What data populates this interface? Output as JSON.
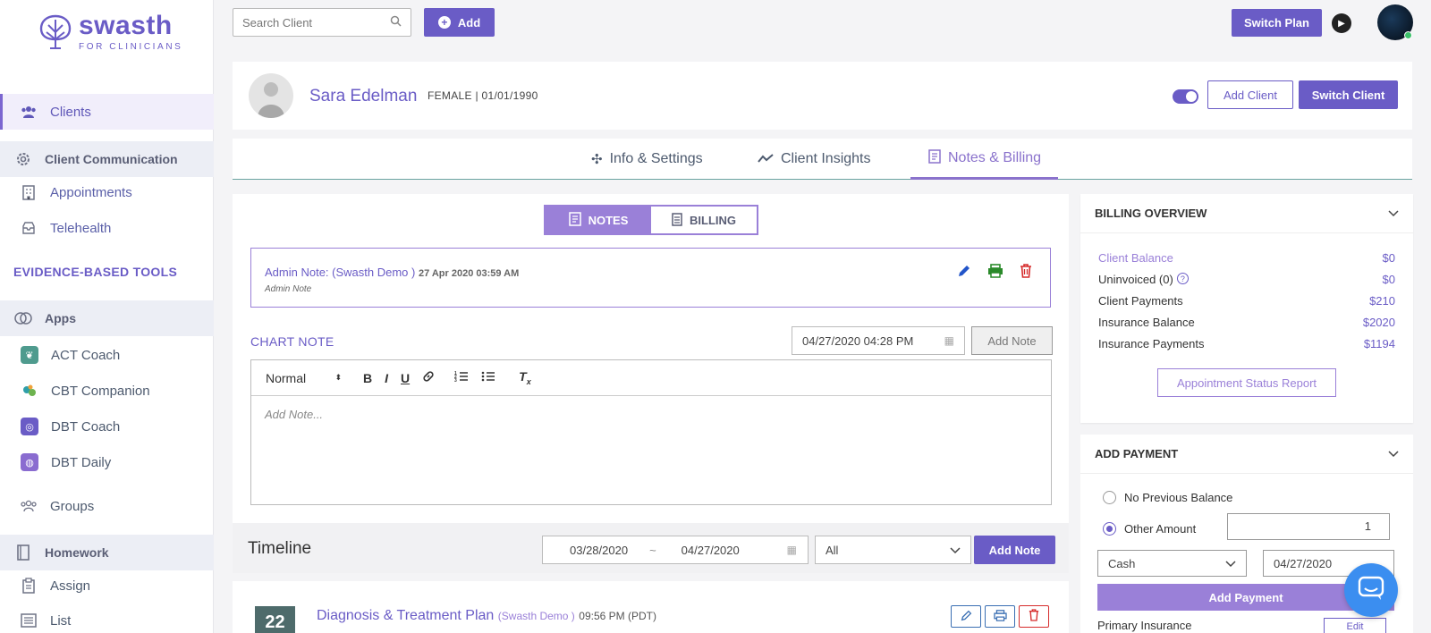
{
  "brand": {
    "name": "swasth",
    "tagline": "FOR CLINICIANS",
    "color": "#6a5cc6"
  },
  "sidebar": {
    "clients": "Clients",
    "client_communication": "Client Communication",
    "appointments": "Appointments",
    "telehealth": "Telehealth",
    "tools_heading": "EVIDENCE-BASED TOOLS",
    "apps": "Apps",
    "act_coach": "ACT Coach",
    "cbt_companion": "CBT Companion",
    "dbt_coach": "DBT Coach",
    "dbt_daily": "DBT Daily",
    "groups": "Groups",
    "homework": "Homework",
    "assign": "Assign",
    "list": "List"
  },
  "topbar": {
    "search_placeholder": "Search Client",
    "add_label": "Add",
    "switch_plan": "Switch Plan"
  },
  "client": {
    "name": "Sara Edelman",
    "meta": "FEMALE | 01/01/1990",
    "add_client": "Add Client",
    "switch_client": "Switch Client"
  },
  "tabs": {
    "info": "Info & Settings",
    "insights": "Client Insights",
    "notes_billing": "Notes & Billing"
  },
  "notes": {
    "seg_notes": "NOTES",
    "seg_billing": "BILLING",
    "admin_note_title": "Admin Note:  (Swasth Demo )",
    "admin_note_date": "27 Apr 2020 03:59 AM",
    "admin_note_sub": "Admin Note",
    "chart_note_label": "CHART NOTE",
    "chart_note_date": "04/27/2020 04:28 PM",
    "add_note": "Add Note",
    "format_select": "Normal",
    "editor_placeholder": "Add Note..."
  },
  "timeline": {
    "title": "Timeline",
    "range_start": "03/28/2020",
    "range_sep": "~",
    "range_end": "04/27/2020",
    "filter": "All",
    "add_note": "Add Note",
    "item": {
      "day": "22",
      "title": "Diagnosis & Treatment Plan",
      "author": "(Swasth Demo )",
      "time": "09:56 PM (PDT)"
    }
  },
  "billing_overview": {
    "title": "BILLING OVERVIEW",
    "rows": [
      {
        "label": "Client Balance",
        "value": "$0"
      },
      {
        "label": "Uninvoiced (0)",
        "value": "$0"
      },
      {
        "label": "Client Payments",
        "value": "$210"
      },
      {
        "label": "Insurance Balance",
        "value": "$2020"
      },
      {
        "label": "Insurance Payments",
        "value": "$1194"
      }
    ],
    "report_button": "Appointment Status Report"
  },
  "add_payment": {
    "title": "ADD PAYMENT",
    "no_previous_balance": "No Previous Balance",
    "other_amount": "Other Amount",
    "amount_value": "1",
    "method": "Cash",
    "date": "04/27/2020",
    "button": "Add Payment",
    "primary_insurance": "Primary Insurance",
    "edit": "Edit"
  }
}
